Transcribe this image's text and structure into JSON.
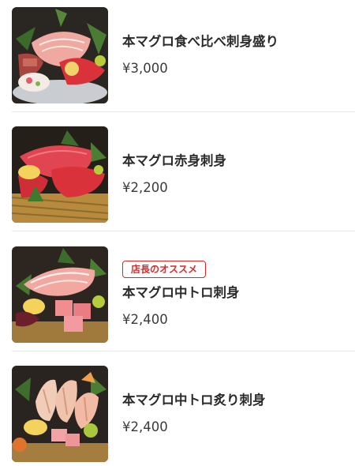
{
  "items": [
    {
      "name": "本マグロ食べ比べ刺身盛り",
      "price": "¥3,000",
      "badge": "",
      "image_icon": "tuna-assorted-sashimi-image"
    },
    {
      "name": "本マグロ赤身刺身",
      "price": "¥2,200",
      "badge": "",
      "image_icon": "tuna-akami-sashimi-image"
    },
    {
      "name": "本マグロ中トロ刺身",
      "price": "¥2,400",
      "badge": "店長のオススメ",
      "image_icon": "tuna-chutoro-sashimi-image"
    },
    {
      "name": "本マグロ中トロ炙り刺身",
      "price": "¥2,400",
      "badge": "",
      "image_icon": "tuna-seared-chutoro-sashimi-image"
    }
  ],
  "colors": {
    "badge": "#d62b2b",
    "text": "#2a2a2a",
    "divider": "#e8e8e8"
  }
}
